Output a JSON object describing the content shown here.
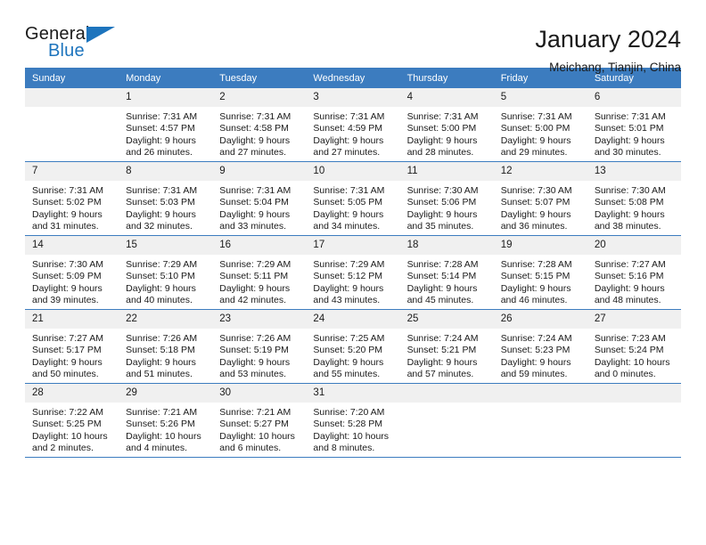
{
  "logo": {
    "word_one": "General",
    "word_two": "Blue",
    "accent_color": "#1d74bd",
    "triangle_icon": "triangle-icon"
  },
  "header": {
    "title": "January 2024",
    "location": "Meichang, Tianjin, China"
  },
  "theme": {
    "header_blue": "#3c7cbf",
    "daynum_bg": "#f0f0f0",
    "text": "#1a1a1a"
  },
  "weekday_headers": [
    "Sunday",
    "Monday",
    "Tuesday",
    "Wednesday",
    "Thursday",
    "Friday",
    "Saturday"
  ],
  "weeks": [
    [
      {
        "day": "",
        "blank": true
      },
      {
        "day": "1",
        "sunrise": "Sunrise: 7:31 AM",
        "sunset": "Sunset: 4:57 PM",
        "daylight_1": "Daylight: 9 hours",
        "daylight_2": "and 26 minutes."
      },
      {
        "day": "2",
        "sunrise": "Sunrise: 7:31 AM",
        "sunset": "Sunset: 4:58 PM",
        "daylight_1": "Daylight: 9 hours",
        "daylight_2": "and 27 minutes."
      },
      {
        "day": "3",
        "sunrise": "Sunrise: 7:31 AM",
        "sunset": "Sunset: 4:59 PM",
        "daylight_1": "Daylight: 9 hours",
        "daylight_2": "and 27 minutes."
      },
      {
        "day": "4",
        "sunrise": "Sunrise: 7:31 AM",
        "sunset": "Sunset: 5:00 PM",
        "daylight_1": "Daylight: 9 hours",
        "daylight_2": "and 28 minutes."
      },
      {
        "day": "5",
        "sunrise": "Sunrise: 7:31 AM",
        "sunset": "Sunset: 5:00 PM",
        "daylight_1": "Daylight: 9 hours",
        "daylight_2": "and 29 minutes."
      },
      {
        "day": "6",
        "sunrise": "Sunrise: 7:31 AM",
        "sunset": "Sunset: 5:01 PM",
        "daylight_1": "Daylight: 9 hours",
        "daylight_2": "and 30 minutes."
      }
    ],
    [
      {
        "day": "7",
        "sunrise": "Sunrise: 7:31 AM",
        "sunset": "Sunset: 5:02 PM",
        "daylight_1": "Daylight: 9 hours",
        "daylight_2": "and 31 minutes."
      },
      {
        "day": "8",
        "sunrise": "Sunrise: 7:31 AM",
        "sunset": "Sunset: 5:03 PM",
        "daylight_1": "Daylight: 9 hours",
        "daylight_2": "and 32 minutes."
      },
      {
        "day": "9",
        "sunrise": "Sunrise: 7:31 AM",
        "sunset": "Sunset: 5:04 PM",
        "daylight_1": "Daylight: 9 hours",
        "daylight_2": "and 33 minutes."
      },
      {
        "day": "10",
        "sunrise": "Sunrise: 7:31 AM",
        "sunset": "Sunset: 5:05 PM",
        "daylight_1": "Daylight: 9 hours",
        "daylight_2": "and 34 minutes."
      },
      {
        "day": "11",
        "sunrise": "Sunrise: 7:30 AM",
        "sunset": "Sunset: 5:06 PM",
        "daylight_1": "Daylight: 9 hours",
        "daylight_2": "and 35 minutes."
      },
      {
        "day": "12",
        "sunrise": "Sunrise: 7:30 AM",
        "sunset": "Sunset: 5:07 PM",
        "daylight_1": "Daylight: 9 hours",
        "daylight_2": "and 36 minutes."
      },
      {
        "day": "13",
        "sunrise": "Sunrise: 7:30 AM",
        "sunset": "Sunset: 5:08 PM",
        "daylight_1": "Daylight: 9 hours",
        "daylight_2": "and 38 minutes."
      }
    ],
    [
      {
        "day": "14",
        "sunrise": "Sunrise: 7:30 AM",
        "sunset": "Sunset: 5:09 PM",
        "daylight_1": "Daylight: 9 hours",
        "daylight_2": "and 39 minutes."
      },
      {
        "day": "15",
        "sunrise": "Sunrise: 7:29 AM",
        "sunset": "Sunset: 5:10 PM",
        "daylight_1": "Daylight: 9 hours",
        "daylight_2": "and 40 minutes."
      },
      {
        "day": "16",
        "sunrise": "Sunrise: 7:29 AM",
        "sunset": "Sunset: 5:11 PM",
        "daylight_1": "Daylight: 9 hours",
        "daylight_2": "and 42 minutes."
      },
      {
        "day": "17",
        "sunrise": "Sunrise: 7:29 AM",
        "sunset": "Sunset: 5:12 PM",
        "daylight_1": "Daylight: 9 hours",
        "daylight_2": "and 43 minutes."
      },
      {
        "day": "18",
        "sunrise": "Sunrise: 7:28 AM",
        "sunset": "Sunset: 5:14 PM",
        "daylight_1": "Daylight: 9 hours",
        "daylight_2": "and 45 minutes."
      },
      {
        "day": "19",
        "sunrise": "Sunrise: 7:28 AM",
        "sunset": "Sunset: 5:15 PM",
        "daylight_1": "Daylight: 9 hours",
        "daylight_2": "and 46 minutes."
      },
      {
        "day": "20",
        "sunrise": "Sunrise: 7:27 AM",
        "sunset": "Sunset: 5:16 PM",
        "daylight_1": "Daylight: 9 hours",
        "daylight_2": "and 48 minutes."
      }
    ],
    [
      {
        "day": "21",
        "sunrise": "Sunrise: 7:27 AM",
        "sunset": "Sunset: 5:17 PM",
        "daylight_1": "Daylight: 9 hours",
        "daylight_2": "and 50 minutes."
      },
      {
        "day": "22",
        "sunrise": "Sunrise: 7:26 AM",
        "sunset": "Sunset: 5:18 PM",
        "daylight_1": "Daylight: 9 hours",
        "daylight_2": "and 51 minutes."
      },
      {
        "day": "23",
        "sunrise": "Sunrise: 7:26 AM",
        "sunset": "Sunset: 5:19 PM",
        "daylight_1": "Daylight: 9 hours",
        "daylight_2": "and 53 minutes."
      },
      {
        "day": "24",
        "sunrise": "Sunrise: 7:25 AM",
        "sunset": "Sunset: 5:20 PM",
        "daylight_1": "Daylight: 9 hours",
        "daylight_2": "and 55 minutes."
      },
      {
        "day": "25",
        "sunrise": "Sunrise: 7:24 AM",
        "sunset": "Sunset: 5:21 PM",
        "daylight_1": "Daylight: 9 hours",
        "daylight_2": "and 57 minutes."
      },
      {
        "day": "26",
        "sunrise": "Sunrise: 7:24 AM",
        "sunset": "Sunset: 5:23 PM",
        "daylight_1": "Daylight: 9 hours",
        "daylight_2": "and 59 minutes."
      },
      {
        "day": "27",
        "sunrise": "Sunrise: 7:23 AM",
        "sunset": "Sunset: 5:24 PM",
        "daylight_1": "Daylight: 10 hours",
        "daylight_2": "and 0 minutes."
      }
    ],
    [
      {
        "day": "28",
        "sunrise": "Sunrise: 7:22 AM",
        "sunset": "Sunset: 5:25 PM",
        "daylight_1": "Daylight: 10 hours",
        "daylight_2": "and 2 minutes."
      },
      {
        "day": "29",
        "sunrise": "Sunrise: 7:21 AM",
        "sunset": "Sunset: 5:26 PM",
        "daylight_1": "Daylight: 10 hours",
        "daylight_2": "and 4 minutes."
      },
      {
        "day": "30",
        "sunrise": "Sunrise: 7:21 AM",
        "sunset": "Sunset: 5:27 PM",
        "daylight_1": "Daylight: 10 hours",
        "daylight_2": "and 6 minutes."
      },
      {
        "day": "31",
        "sunrise": "Sunrise: 7:20 AM",
        "sunset": "Sunset: 5:28 PM",
        "daylight_1": "Daylight: 10 hours",
        "daylight_2": "and 8 minutes."
      },
      {
        "day": "",
        "blank": true
      },
      {
        "day": "",
        "blank": true
      },
      {
        "day": "",
        "blank": true
      }
    ]
  ]
}
